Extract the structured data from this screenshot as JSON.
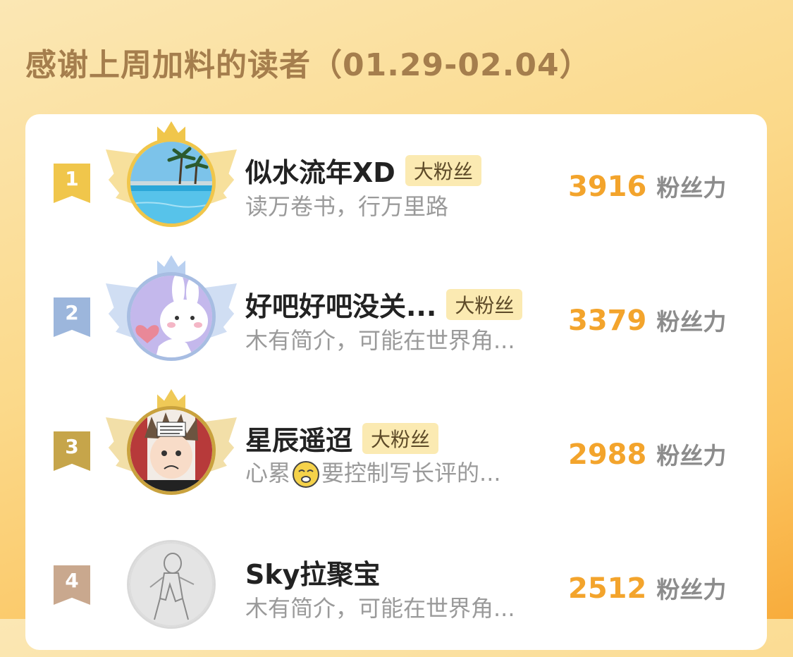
{
  "header": {
    "title": "感谢上周加料的读者（01.29-02.04）"
  },
  "colors": {
    "accent": "#f3a42c",
    "gold": "#f0c64b",
    "silver": "#9cb6dc",
    "bronze": "#c6a54a",
    "fourth": "#c9a88e"
  },
  "readers": [
    {
      "rank": "1",
      "name": "似水流年XD",
      "badge": "大粉丝",
      "bio": "读万卷书，行万里路",
      "score": "3916",
      "unit": "粉丝力",
      "avatar_icon": "beach-pool-photo"
    },
    {
      "rank": "2",
      "name": "好吧好吧没关...",
      "badge": "大粉丝",
      "bio": "木有简介，可能在世界角...",
      "score": "3379",
      "unit": "粉丝力",
      "avatar_icon": "bunny-illustration"
    },
    {
      "rank": "3",
      "name": "星辰遥迢",
      "badge": "大粉丝",
      "bio_before": "心累",
      "bio_emoji": "tired-face-emoji",
      "bio_after": "要控制写长评的...",
      "score": "2988",
      "unit": "粉丝力",
      "avatar_icon": "manga-character"
    },
    {
      "rank": "4",
      "name": "Sky拉聚宝",
      "bio": "木有简介，可能在世界角...",
      "score": "2512",
      "unit": "粉丝力",
      "avatar_icon": "pencil-sketch"
    }
  ]
}
